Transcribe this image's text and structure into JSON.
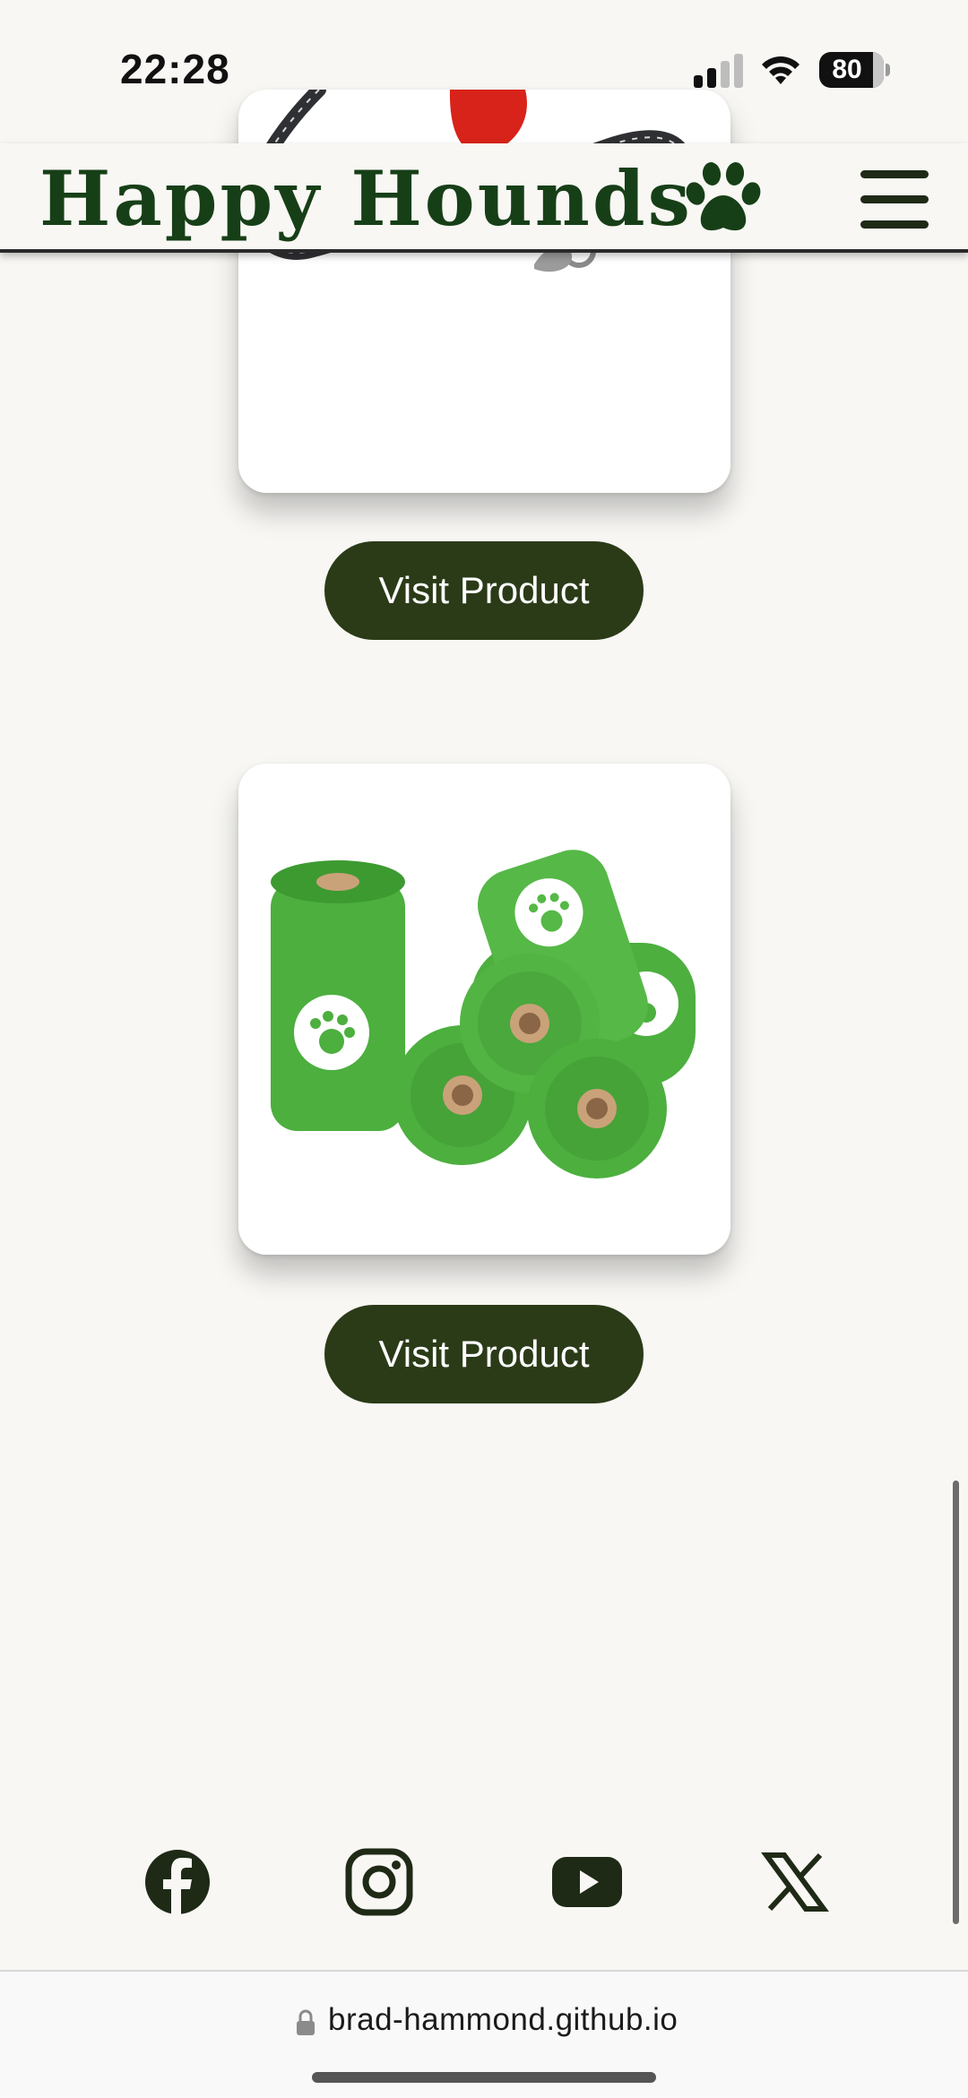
{
  "status_bar": {
    "time": "22:28",
    "battery": "80",
    "icons": [
      "signal-icon",
      "wifi-icon",
      "battery-icon"
    ]
  },
  "header": {
    "title": "Happy Hounds",
    "logo_icon": "paw-icon",
    "menu_icon": "hamburger-menu-icon"
  },
  "products": [
    {
      "image": "dog-leash-image",
      "button_label": "Visit Product"
    },
    {
      "image": "poop-bag-rolls-image",
      "button_label": "Visit Product"
    }
  ],
  "footer": {
    "social": [
      "facebook-icon",
      "instagram-icon",
      "youtube-icon",
      "x-icon"
    ]
  },
  "browser": {
    "url": "brad-hammond.github.io"
  },
  "colors": {
    "background": "#f8f7f4",
    "brand_green": "#173f17",
    "button_bg": "#2b3b18",
    "bag_green": "#4caf3e"
  }
}
